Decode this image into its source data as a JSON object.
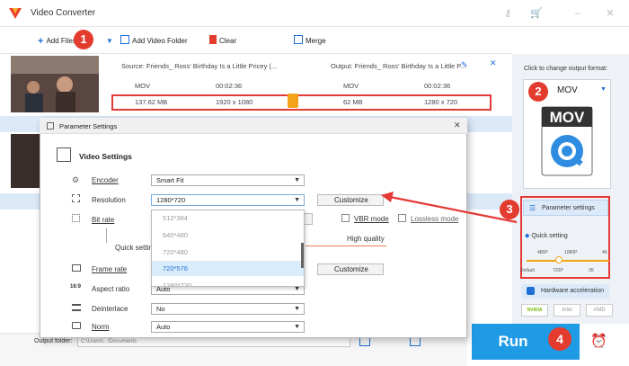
{
  "window": {
    "title": "Video Converter"
  },
  "toolbar": {
    "add_files": "Add Files",
    "add_video_folder": "Add Video Folder",
    "clear": "Clear",
    "merge": "Merge"
  },
  "file": {
    "source_label": "Source: Friends_ Ross' Birthday Is a Little Pricey (...",
    "output_label": "Output: Friends_ Ross' Birthday Is a Little P...",
    "source_format": "MOV",
    "source_duration": "00:02:36",
    "source_size": "137.62 MB",
    "source_resolution": "1920 x 1080",
    "output_format": "MOV",
    "output_duration": "00:02:36",
    "output_size": "62 MB",
    "output_resolution": "1280 x 720"
  },
  "right_panel": {
    "hint": "Click to change output format:",
    "format": "MOV",
    "format_icon_text": "MOV",
    "param_settings": "Parameter settings",
    "quick_setting": "Quick setting",
    "ticks_top": [
      "480P",
      "1080P",
      "4K"
    ],
    "ticks_bottom": [
      "Default",
      "720P",
      "2K"
    ],
    "hw_accel": "Hardware acceleration",
    "nvidia": "NVIDIA",
    "intel": "Intel",
    "amd": "AMD"
  },
  "run": {
    "label": "Run"
  },
  "output_bar": {
    "label": "Output folder:",
    "path": "C:\\Users\\...\\Documents"
  },
  "dialog": {
    "title": "Parameter Settings",
    "section": "Video Settings",
    "encoder_label": "Encoder",
    "encoder_value": "Smart Fit",
    "resolution_label": "Resolution",
    "resolution_value": "1280*720",
    "customize": "Customize",
    "bitrate_label": "Bit rate",
    "vbr_mode": "VBR mode",
    "lossless_mode": "Lossless mode",
    "quick_setting": "Quick setting",
    "high_quality": "High quality",
    "framerate_label": "Frame rate",
    "aspect_label": "Aspect ratio",
    "aspect_value": "Auto",
    "deinterlace_label": "Deinterlace",
    "deinterlace_value": "No",
    "norm_label": "Norm",
    "norm_value": "Auto",
    "resolution_options": [
      "512*384",
      "640*480",
      "720*480",
      "720*576",
      "1280*720"
    ],
    "selected_option": "720*576"
  },
  "steps": [
    "1",
    "2",
    "3",
    "4"
  ],
  "colors": {
    "accent": "#1f9be6",
    "step_badge": "#e33b2e",
    "highlight": "#e53935",
    "row_blue": "#dbe9f9"
  }
}
